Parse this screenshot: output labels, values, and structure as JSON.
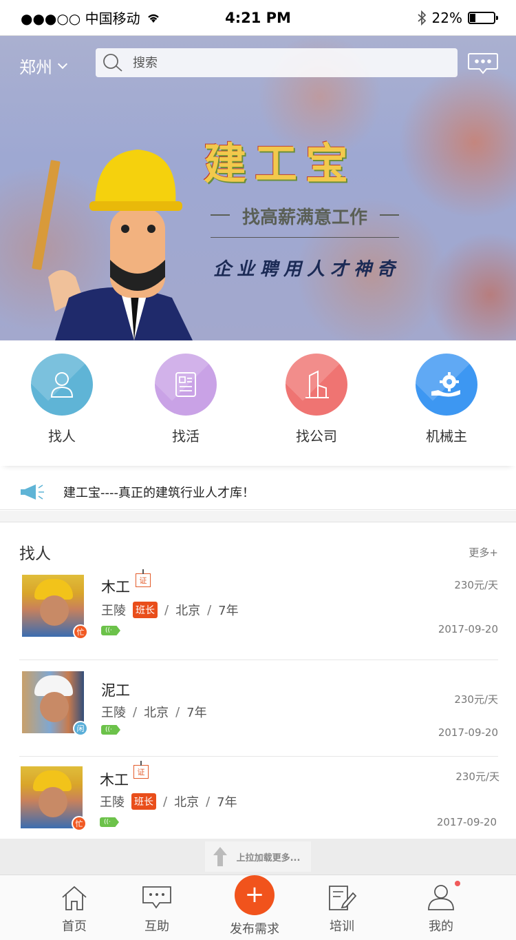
{
  "status_bar": {
    "carrier": "●●●○○ 中国移动",
    "time": "4:21 PM",
    "battery": "22%",
    "battery_level": 0.22
  },
  "header": {
    "city": "郑州",
    "search_placeholder": "搜索"
  },
  "banner": {
    "title": "建工宝",
    "subtitle": "找高薪满意工作",
    "slogan": "企业聘用人才神奇"
  },
  "categories": [
    {
      "label": "找人",
      "color": "#5fb4d6",
      "icon": "person-icon"
    },
    {
      "label": "找活",
      "color": "#c9a2e6",
      "icon": "resume-icon"
    },
    {
      "label": "找公司",
      "color": "#ef7472",
      "icon": "building-icon"
    },
    {
      "label": "机械主",
      "color": "#3d97f2",
      "icon": "gear-hand-icon"
    }
  ],
  "notice": {
    "text": "建工宝----真正的建筑行业人才库！"
  },
  "section": {
    "title": "找人",
    "more": "更多+"
  },
  "workers": [
    {
      "job": "木工",
      "cert": "证",
      "name": "王陵",
      "tag": "班长",
      "city": "北京",
      "years": "7年",
      "status": "忙",
      "price": "230元/天",
      "date": "2017-09-20"
    },
    {
      "job": "泥工",
      "name": "王陵",
      "city": "北京",
      "years": "7年",
      "status": "闲",
      "price": "230元/天",
      "date": "2017-09-20"
    },
    {
      "job": "木工",
      "cert": "证",
      "name": "王陵",
      "tag": "班长",
      "city": "北京",
      "years": "7年",
      "status": "忙",
      "price": "230元/天",
      "date": "2017-09-20"
    }
  ],
  "voice_label": "((·",
  "load_more": "上拉加载更多...",
  "tabs": [
    {
      "label": "首页",
      "icon": "home-icon"
    },
    {
      "label": "互助",
      "icon": "chat-icon"
    },
    {
      "label": "发布需求",
      "icon": "plus-icon"
    },
    {
      "label": "培训",
      "icon": "edit-doc-icon"
    },
    {
      "label": "我的",
      "icon": "user-icon"
    }
  ],
  "colors": {
    "accent": "#f1531c",
    "tag": "#e94e1b",
    "voice": "#6cc24a"
  }
}
